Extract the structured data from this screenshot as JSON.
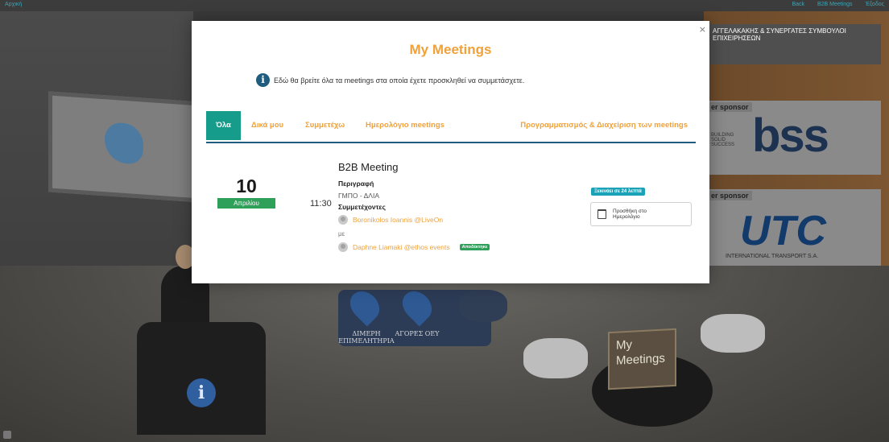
{
  "topbar": {
    "home_label": "Αρχική",
    "nav": [
      "Back",
      "B2B Meetings",
      "Έξοδος"
    ]
  },
  "background": {
    "banner_top_text": "ΑΓΓΕΛΑΚΑΚΗΣ & ΣΥΝΕΡΓΑΤΕΣ ΣΥΜΒΟΥΛΟΙ ΕΠΙΧΕΙΡΗΣΕΩΝ",
    "sponsor_label_1": "er sponsor",
    "sponsor_label_2": "er sponsor",
    "bss_tagline": "BUILDING SOLID SUCCESS",
    "bss_logo": "bss",
    "utc_logo": "UTC",
    "utc_sub": "INTERNATIONAL TRANSPORT S.A.",
    "pin_1_label": "ΔΙΜΕΡΗ ΕΠΙΜΕΛΗΤΗΡΙΑ",
    "pin_2_label": "ΑΓΟΡΕΣ ΟΕΥ",
    "sign_text": "My Meetings",
    "info_desk_glyph": "i"
  },
  "modal": {
    "close_label": "×",
    "title": "My Meetings",
    "info_text": "Εδώ θα βρείτε όλα τα meetings στα οποία έχετε προσκληθεί να συμμετάσχετε.",
    "tabs": [
      {
        "label": "Όλα",
        "active": true
      },
      {
        "label": "Δικά μου",
        "active": false
      },
      {
        "label": "Συμμετέχω",
        "active": false
      },
      {
        "label": "Ημερολόγιο meetings",
        "active": false
      },
      {
        "label": "Προγραμματισμός & Διαχείριση των meetings",
        "active": false
      }
    ],
    "meeting": {
      "day": "10",
      "month": "Απριλίου",
      "time": "11:30",
      "title": "B2B Meeting",
      "description_label": "Περιγραφή",
      "description": "ΓΜΠΟ - ΔΛΙΑ",
      "participants_label": "Συμμετέχοντες",
      "participant_1": "Boronikolos Ioannis @LiveOn",
      "with_text": "με",
      "participant_2": "Daphne Liamaki @ethos events",
      "participant_2_status": "Αποδέκτηκε",
      "starts_in": "Ξεκινάει σε 24 λεπτά",
      "add_calendar": "Προσθήκη στο Ημερολόγιο"
    }
  },
  "colors": {
    "accent_orange": "#f0a13a",
    "tab_active": "#159c8b",
    "date_green": "#2ea05a",
    "badge_teal": "#1aa3b8",
    "tab_underline": "#1f5c7d"
  }
}
